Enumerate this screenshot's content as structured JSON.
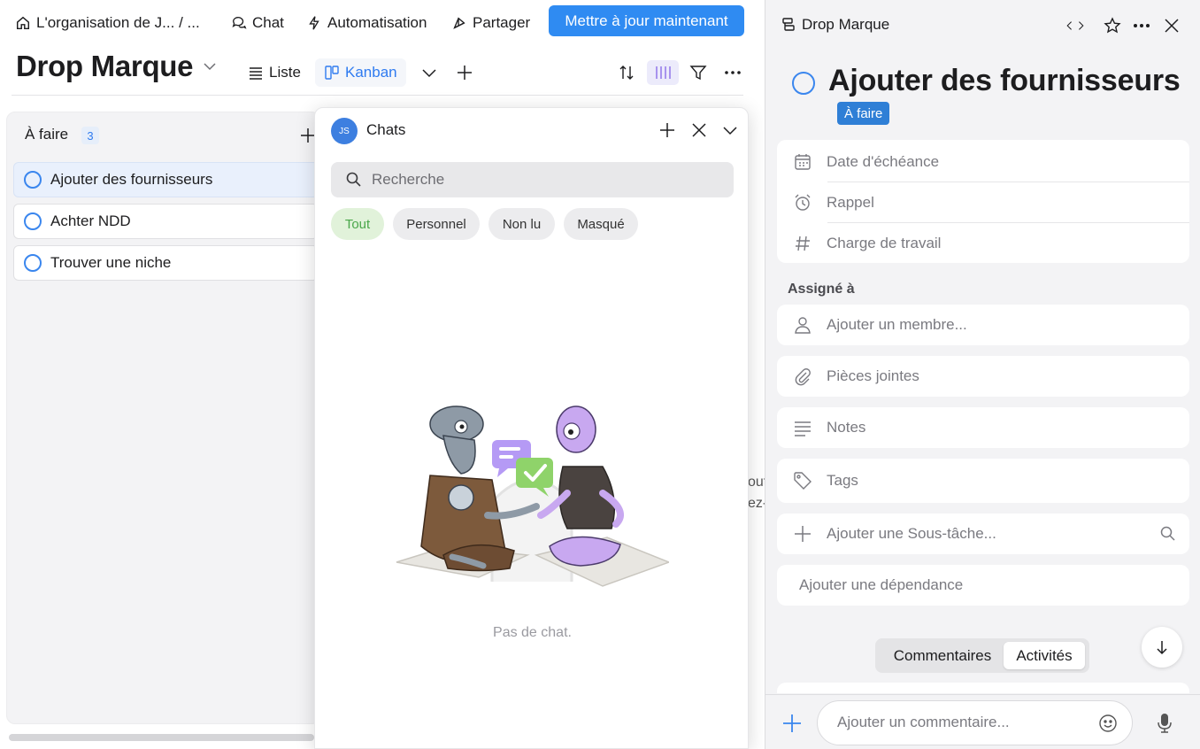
{
  "topbar": {
    "breadcrumb": "L'organisation de J... / ...",
    "chat": "Chat",
    "automation": "Automatisation",
    "share": "Partager",
    "update_button": "Mettre à jour maintenant"
  },
  "project": {
    "title": "Drop Marque",
    "views": {
      "list": "Liste",
      "kanban": "Kanban"
    }
  },
  "board": {
    "column_title": "À faire",
    "column_count": "3",
    "cards": [
      {
        "label": "Ajouter des fournisseurs"
      },
      {
        "label": "Achter NDD"
      },
      {
        "label": "Trouver une niche"
      }
    ],
    "partial_text_line1": "out",
    "partial_text_line2": "ez-"
  },
  "chats": {
    "avatar_initials": "JS",
    "title": "Chats",
    "search_placeholder": "Recherche",
    "filters": [
      "Tout",
      "Personnel",
      "Non lu",
      "Masqué"
    ],
    "empty_text": "Pas de chat."
  },
  "detail": {
    "project_name": "Drop Marque",
    "task_title": "Ajouter des fournisseurs",
    "status": "À faire",
    "fields": {
      "due_date": "Date d'échéance",
      "reminder": "Rappel",
      "workload": "Charge de travail"
    },
    "assigned_label": "Assigné à",
    "add_member": "Ajouter un membre...",
    "attachments": "Pièces jointes",
    "notes": "Notes",
    "tags": "Tags",
    "add_subtask": "Ajouter une Sous-tâche...",
    "add_dependency": "Ajouter une dépendance",
    "tabs": {
      "comments": "Commentaires",
      "activity": "Activités"
    },
    "comment_placeholder": "Ajouter un commentaire..."
  },
  "colors": {
    "accent": "#2f8bf2",
    "status_badge": "#2f7fd6",
    "filter_active_bg": "#e1f2da",
    "filter_active_text": "#4aa74a"
  }
}
